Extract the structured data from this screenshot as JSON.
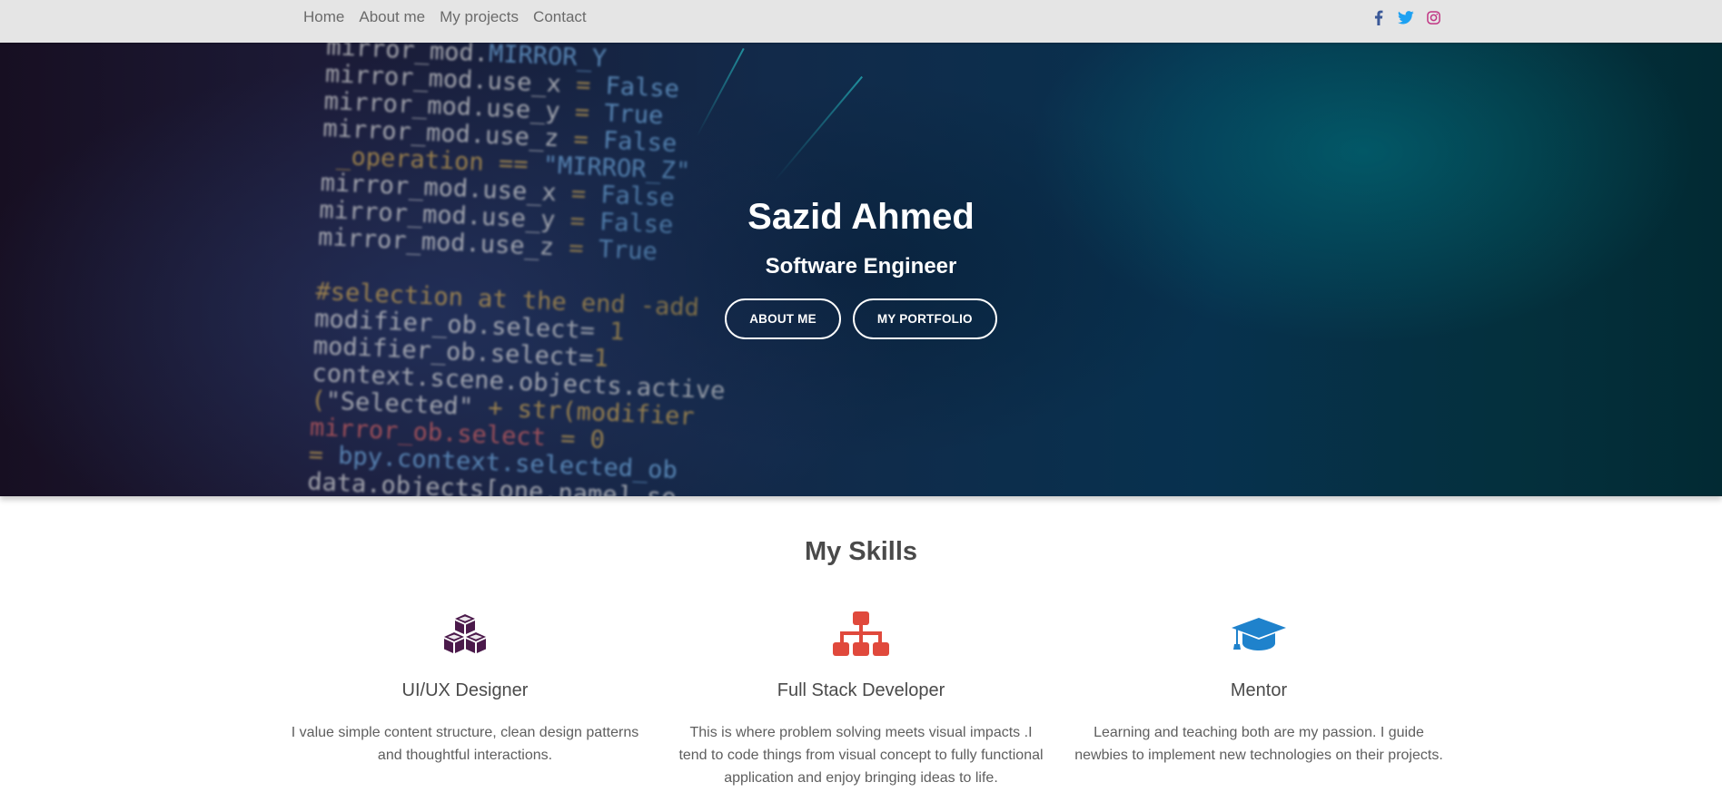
{
  "nav": {
    "items": [
      {
        "label": "Home"
      },
      {
        "label": "About me"
      },
      {
        "label": "My projects"
      },
      {
        "label": "Contact"
      }
    ],
    "social": [
      "facebook-icon",
      "twitter-icon",
      "instagram-icon"
    ]
  },
  "hero": {
    "name": "Sazid Ahmed",
    "title": "Software Engineer",
    "buttons": {
      "about": "ABOUT ME",
      "portfolio": "MY PORTFOLIO"
    }
  },
  "skills": {
    "heading": "My Skills",
    "items": [
      {
        "icon": "cubes-icon",
        "color": "#4b1a4b",
        "name": "UI/UX Designer",
        "desc_lines": [
          "I value simple content structure, clean design patterns",
          "and thoughtful interactions."
        ]
      },
      {
        "icon": "sitemap-icon",
        "color": "#e0493c",
        "name": "Full Stack Developer",
        "desc_lines": [
          "This is where problem solving meets visual impacts .I",
          "tend to code things from visual concept to fully functional",
          "application and enjoy bringing ideas to life."
        ]
      },
      {
        "icon": "graduation-cap-icon",
        "color": "#1f82cc",
        "name": "Mentor",
        "desc_lines": [
          "Learning and teaching both are my passion. I guide",
          "newbies to implement new technologies on their projects."
        ]
      }
    ]
  },
  "colors": {
    "nav_bg": "#e5e5e5",
    "facebook": "#3b5998",
    "twitter": "#1da1f2",
    "instagram": "#c13584"
  }
}
